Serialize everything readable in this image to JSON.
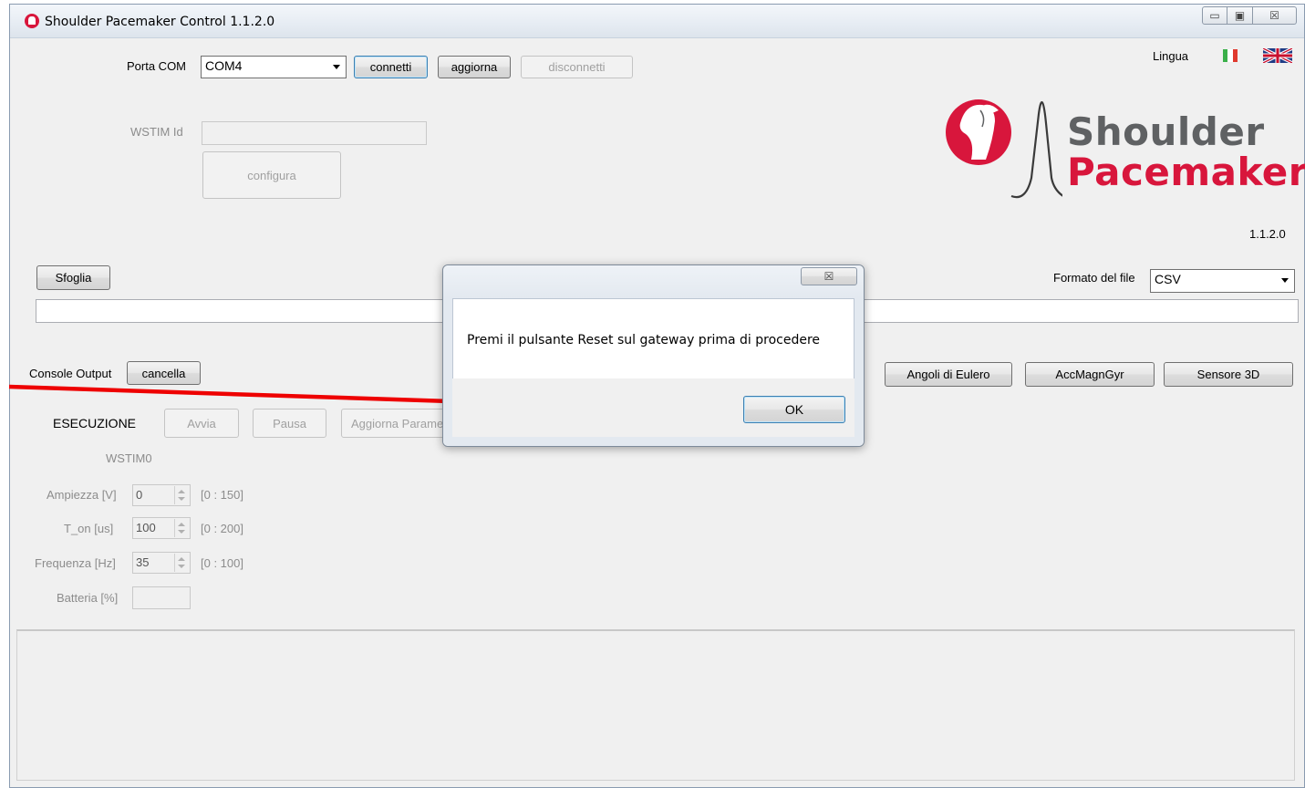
{
  "window": {
    "title": "Shoulder Pacemaker Control 1.1.2.0",
    "controls": {
      "minimize": "▭",
      "maximize": "▣",
      "close": "☒"
    }
  },
  "connection": {
    "port_label": "Porta COM",
    "port_value": "COM4",
    "connect_label": "connetti",
    "refresh_label": "aggiorna",
    "disconnect_label": "disconnetti",
    "wstim_label": "WSTIM Id",
    "wstim_value": "",
    "configure_label": "configura"
  },
  "language": {
    "label": "Lingua",
    "flags": [
      "flag-it-icon",
      "flag-uk-icon"
    ]
  },
  "logo": {
    "line1": "Shoulder",
    "line2": "Pacemaker"
  },
  "version": "1.1.2.0",
  "file": {
    "browse_label": "Sfoglia",
    "path_value": "",
    "format_label": "Formato del file",
    "format_value": "CSV"
  },
  "console": {
    "label": "Console Output",
    "clear_label": "cancella"
  },
  "views": {
    "euler_label": "Angoli di Eulero",
    "accmag_label": "AccMagnGyr",
    "sensor3d_label": "Sensore 3D"
  },
  "execution": {
    "title": "ESECUZIONE",
    "start_label": "Avvia",
    "pause_label": "Pausa",
    "update_label": "Aggiorna Parametri",
    "device_label": "WSTIM0"
  },
  "params": [
    {
      "label": "Ampiezza [V]",
      "value": "0",
      "range": "[0 : 150]"
    },
    {
      "label": "T_on [us]",
      "value": "100",
      "range": "[0 : 200]"
    },
    {
      "label": "Frequenza [Hz]",
      "value": "35",
      "range": "[0 : 100]"
    }
  ],
  "battery": {
    "label": "Batteria [%]",
    "value": ""
  },
  "dialog": {
    "message": "Premi il pulsante Reset sul gateway prima di procedere",
    "ok_label": "OK",
    "close_glyph": "☒"
  },
  "colors": {
    "annotation_arrow": "#ee0000",
    "brand_red": "#d8163c",
    "brand_gray": "#5f6163"
  }
}
